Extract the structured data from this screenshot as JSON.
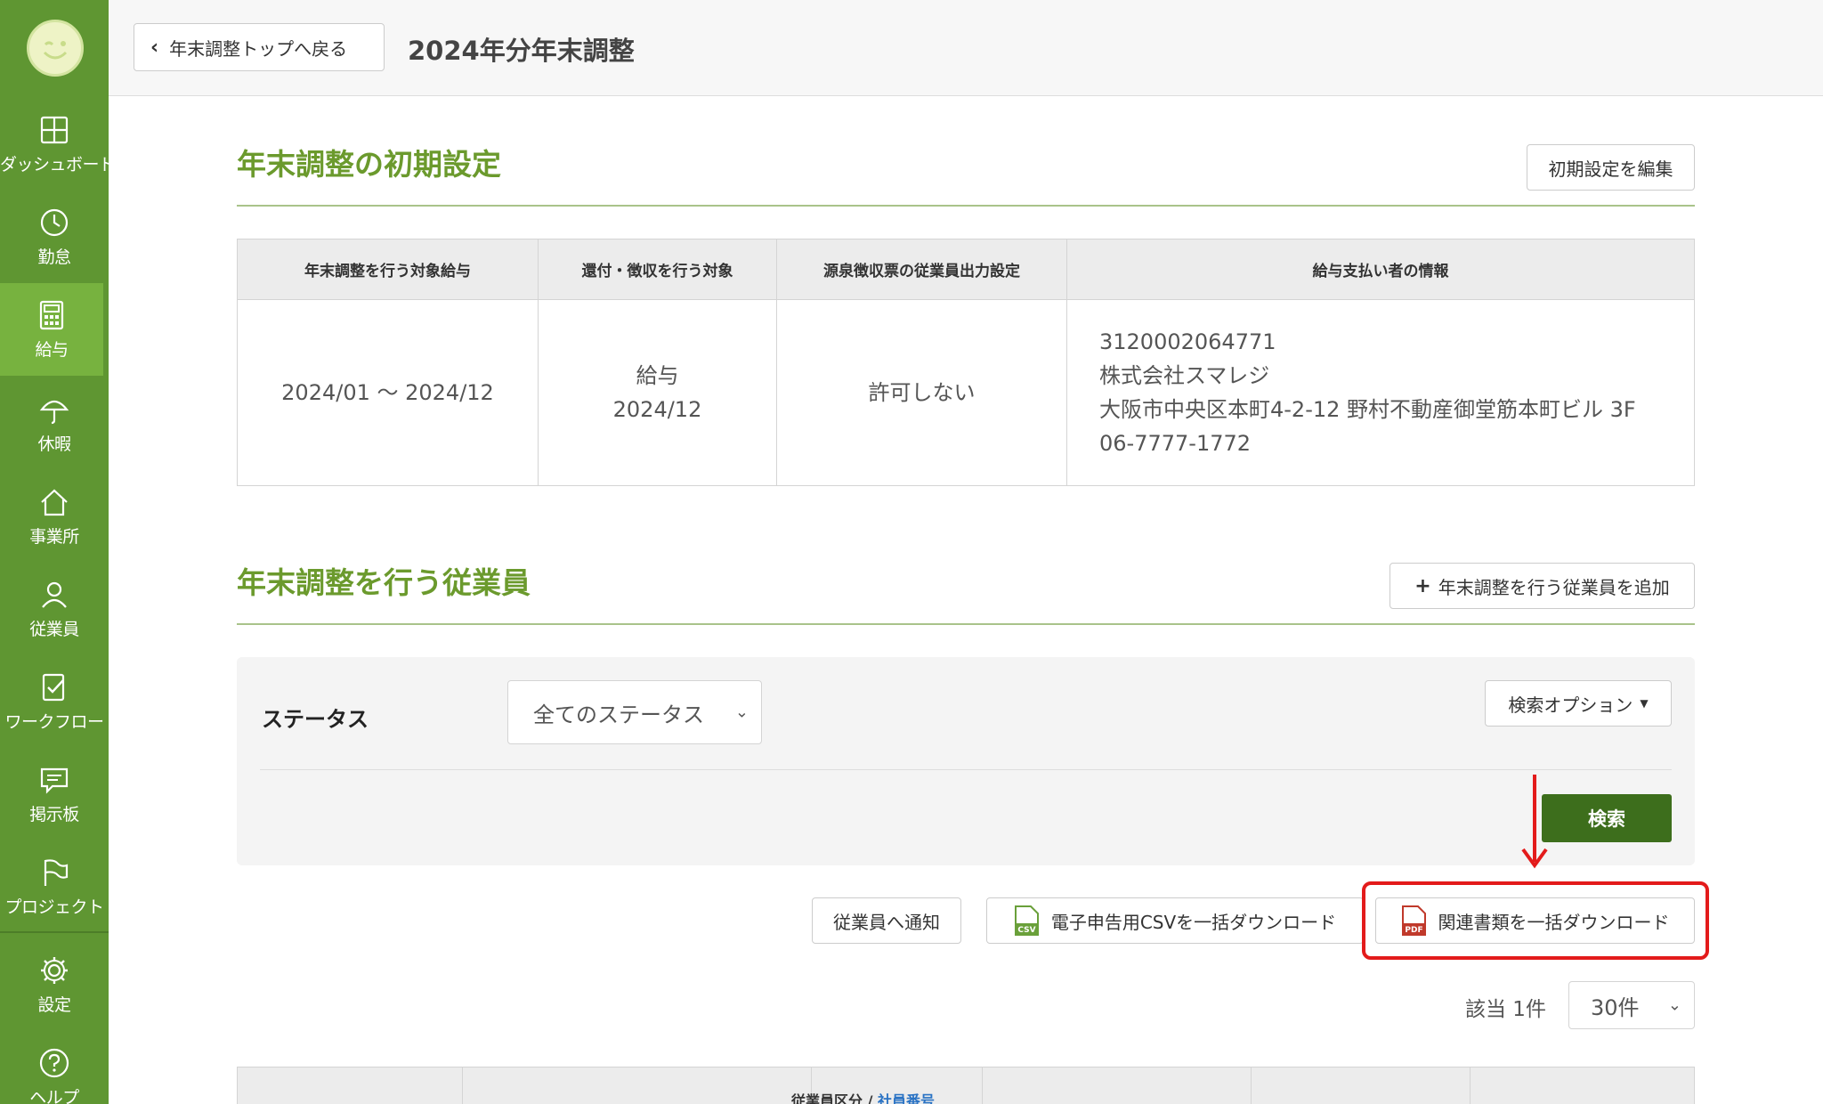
{
  "sidebar": {
    "items": [
      {
        "label": "ダッシュボード",
        "icon": "dashboard-icon"
      },
      {
        "label": "勤怠",
        "icon": "clock-icon"
      },
      {
        "label": "給与",
        "icon": "calculator-icon",
        "active": true
      },
      {
        "label": "休暇",
        "icon": "umbrella-icon"
      },
      {
        "label": "事業所",
        "icon": "house-icon"
      },
      {
        "label": "従業員",
        "icon": "person-icon"
      },
      {
        "label": "ワークフロー",
        "icon": "checklist-icon"
      },
      {
        "label": "掲示板",
        "icon": "chat-icon"
      },
      {
        "label": "プロジェクト",
        "icon": "flag-icon"
      },
      {
        "label": "設定",
        "icon": "gear-icon"
      },
      {
        "label": "ヘルプ",
        "icon": "help-icon"
      }
    ]
  },
  "header": {
    "back_label": "年末調整トップへ戻る",
    "title": "2024年分年末調整"
  },
  "initial_settings": {
    "title": "年末調整の初期設定",
    "edit_button": "初期設定を編集",
    "columns": [
      "年末調整を行う対象給与",
      "還付・徴収を行う対象",
      "源泉徴収票の従業員出力設定",
      "給与支払い者の情報"
    ],
    "target_period": "2024/01 〜 2024/12",
    "refund_target_line1": "給与",
    "refund_target_line2": "2024/12",
    "output_setting": "許可しない",
    "payer": {
      "corporate_number": "3120002064771",
      "company": "株式会社スマレジ",
      "address": "大阪市中央区本町4-2-12 野村不動産御堂筋本町ビル 3F",
      "phone": "06-7777-1772"
    }
  },
  "employees": {
    "title": "年末調整を行う従業員",
    "add_button": "年末調整を行う従業員を追加",
    "filter": {
      "status_label": "ステータス",
      "status_value": "全てのステータス",
      "options_button": "検索オプション",
      "search_button": "検索"
    },
    "actions": {
      "notify": "従業員へ通知",
      "csv_download": "電子申告用CSVを一括ダウンロード",
      "docs_download": "関連書類を一括ダウンロード"
    },
    "count_text": "該当 1件",
    "per_page": "30件",
    "table_header": {
      "category": "従業員区分 / ",
      "number_link": "社員番号"
    }
  },
  "colors": {
    "sidebar": "#5f9632",
    "sidebar_active": "#77b23f",
    "accent_green": "#6b9a2d",
    "search_button": "#3d6e1c",
    "highlight_red": "#e31b1b"
  }
}
